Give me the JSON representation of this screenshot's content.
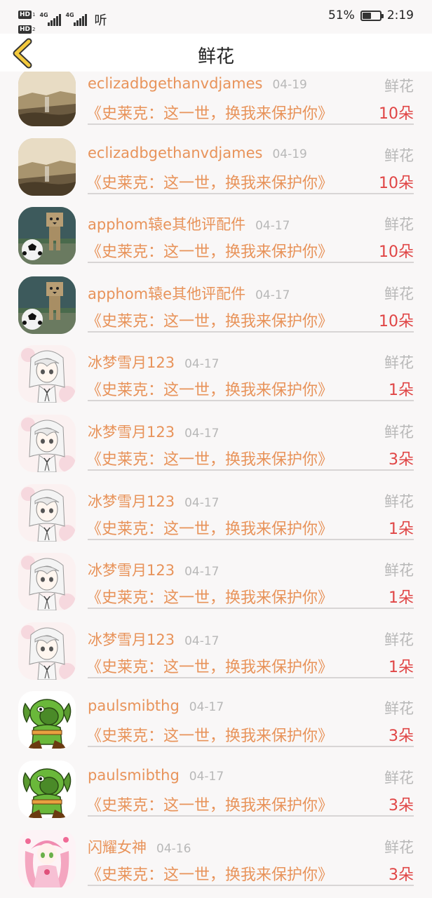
{
  "status_bar": {
    "hd1": "HD",
    "hd1_sub": "1",
    "hd2": "HD",
    "hd2_sub": "2",
    "net1": "4G",
    "net2": "4G",
    "carrier_glyph": "听",
    "battery_percent": "51%",
    "battery_level": 0.51,
    "time": "2:19"
  },
  "header": {
    "back_icon": "chevron-left-icon",
    "title": "鲜花"
  },
  "colors": {
    "name": "#e8935a",
    "book": "#e8935a",
    "count": "#e04545",
    "meta": "#b8b8b8",
    "back_arrow": "#f3c93d"
  },
  "gifts": [
    {
      "avatar": "mountain-avatar",
      "name": "eclizadbgethanvdjames",
      "date": "04-19",
      "type": "鲜花",
      "book": "《史莱克：这一世，换我来保护你》",
      "count": "10朵"
    },
    {
      "avatar": "mountain-avatar",
      "name": "eclizadbgethanvdjames",
      "date": "04-19",
      "type": "鲜花",
      "book": "《史莱克：这一世，换我来保护你》",
      "count": "10朵"
    },
    {
      "avatar": "danbo-avatar",
      "name": "apphom辕e其他评配件",
      "date": "04-17",
      "type": "鲜花",
      "book": "《史莱克：这一世，换我来保护你》",
      "count": "10朵"
    },
    {
      "avatar": "danbo-avatar",
      "name": "apphom辕e其他评配件",
      "date": "04-17",
      "type": "鲜花",
      "book": "《史莱克：这一世，换我来保护你》",
      "count": "10朵"
    },
    {
      "avatar": "anime-girl-avatar",
      "name": "冰梦雪月123",
      "date": "04-17",
      "type": "鲜花",
      "book": "《史莱克：这一世，换我来保护你》",
      "count": "1朵"
    },
    {
      "avatar": "anime-girl-avatar",
      "name": "冰梦雪月123",
      "date": "04-17",
      "type": "鲜花",
      "book": "《史莱克：这一世，换我来保护你》",
      "count": "3朵"
    },
    {
      "avatar": "anime-girl-avatar",
      "name": "冰梦雪月123",
      "date": "04-17",
      "type": "鲜花",
      "book": "《史莱克：这一世，换我来保护你》",
      "count": "1朵"
    },
    {
      "avatar": "anime-girl-avatar",
      "name": "冰梦雪月123",
      "date": "04-17",
      "type": "鲜花",
      "book": "《史莱克：这一世，换我来保护你》",
      "count": "1朵"
    },
    {
      "avatar": "anime-girl-avatar",
      "name": "冰梦雪月123",
      "date": "04-17",
      "type": "鲜花",
      "book": "《史莱克：这一世，换我来保护你》",
      "count": "1朵"
    },
    {
      "avatar": "green-monster-avatar",
      "name": "paulsmibthg",
      "date": "04-17",
      "type": "鲜花",
      "book": "《史莱克：这一世，换我来保护你》",
      "count": "3朵"
    },
    {
      "avatar": "green-monster-avatar",
      "name": "paulsmibthg",
      "date": "04-17",
      "type": "鲜花",
      "book": "《史莱克：这一世，换我来保护你》",
      "count": "3朵"
    },
    {
      "avatar": "pink-anime-avatar",
      "name": "闪耀女神",
      "date": "04-16",
      "type": "鲜花",
      "book": "《史莱克：这一世，换我来保护你》",
      "count": "3朵"
    }
  ]
}
